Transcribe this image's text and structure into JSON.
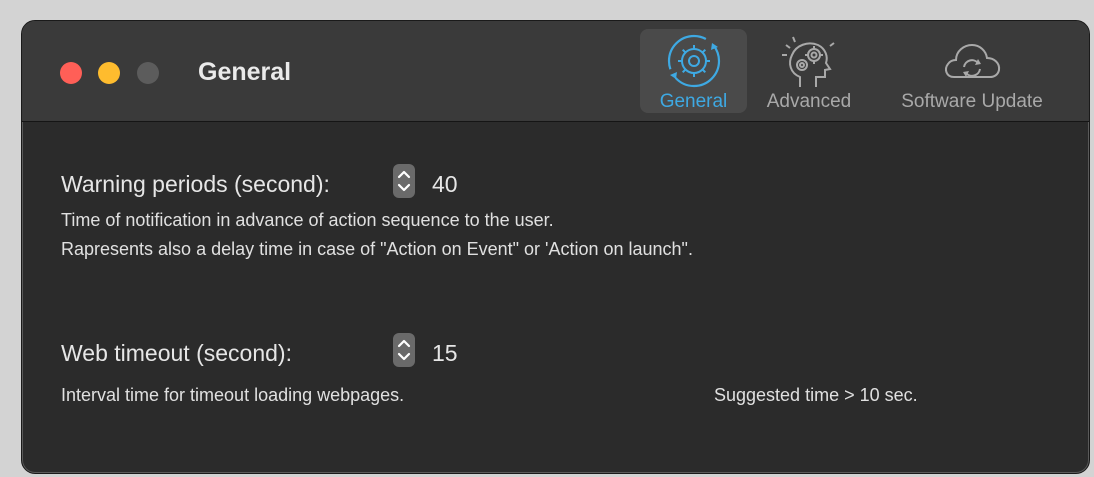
{
  "window": {
    "title": "General"
  },
  "toolbar": {
    "tabs": [
      {
        "label": "General",
        "icon": "gear-refresh-icon",
        "selected": true
      },
      {
        "label": "Advanced",
        "icon": "head-gears-icon",
        "selected": false
      },
      {
        "label": "Software Update",
        "icon": "cloud-refresh-icon",
        "selected": false
      }
    ]
  },
  "colors": {
    "accent": "#3ea9e3",
    "window_bg": "#2b2b2b",
    "titlebar_bg": "#3a3a3a",
    "close": "#ff5f57",
    "minimize": "#febc2e",
    "zoom_inactive": "#5c5c5c"
  },
  "settings": {
    "warning": {
      "label": "Warning periods (second):",
      "value": "40",
      "description_line1": "Time of notification in advance of action sequence to the user.",
      "description_line2": "Rapresents also a delay time in case of \"Action on Event\" or 'Action on launch\"."
    },
    "web_timeout": {
      "label": "Web timeout (second):",
      "value": "15",
      "description": "Interval time for timeout loading webpages.",
      "suggestion": "Suggested time > 10 sec."
    }
  }
}
